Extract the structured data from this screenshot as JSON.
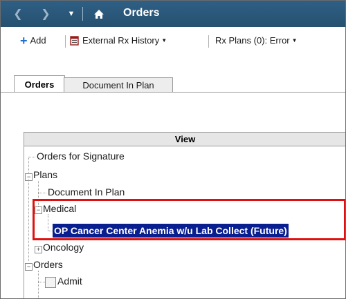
{
  "titlebar": {
    "title": "Orders",
    "icons": [
      "back-arrow-icon",
      "forward-arrow-icon",
      "dropdown-arrow-icon",
      "home-icon"
    ]
  },
  "toolbar": {
    "add_label": "Add",
    "external_rx_label": "External Rx History",
    "rx_plans_label": "Rx Plans (0): Error",
    "accent_color": "#1f6fd1"
  },
  "tabs": [
    {
      "label": "Orders",
      "active": true
    },
    {
      "label": "Document In Plan",
      "active": false
    }
  ],
  "tree": {
    "header": "View",
    "items": {
      "orders_for_signature": "Orders for Signature",
      "plans": "Plans",
      "document_in_plan": "Document In Plan",
      "medical": "Medical",
      "selected_plan": "OP Cancer Center Anemia w/u Lab Collect (Future)",
      "oncology": "Oncology",
      "orders": "Orders",
      "admit": "Admit"
    },
    "selected_color": "#0a1f8f",
    "highlight_color": "#e01010"
  }
}
